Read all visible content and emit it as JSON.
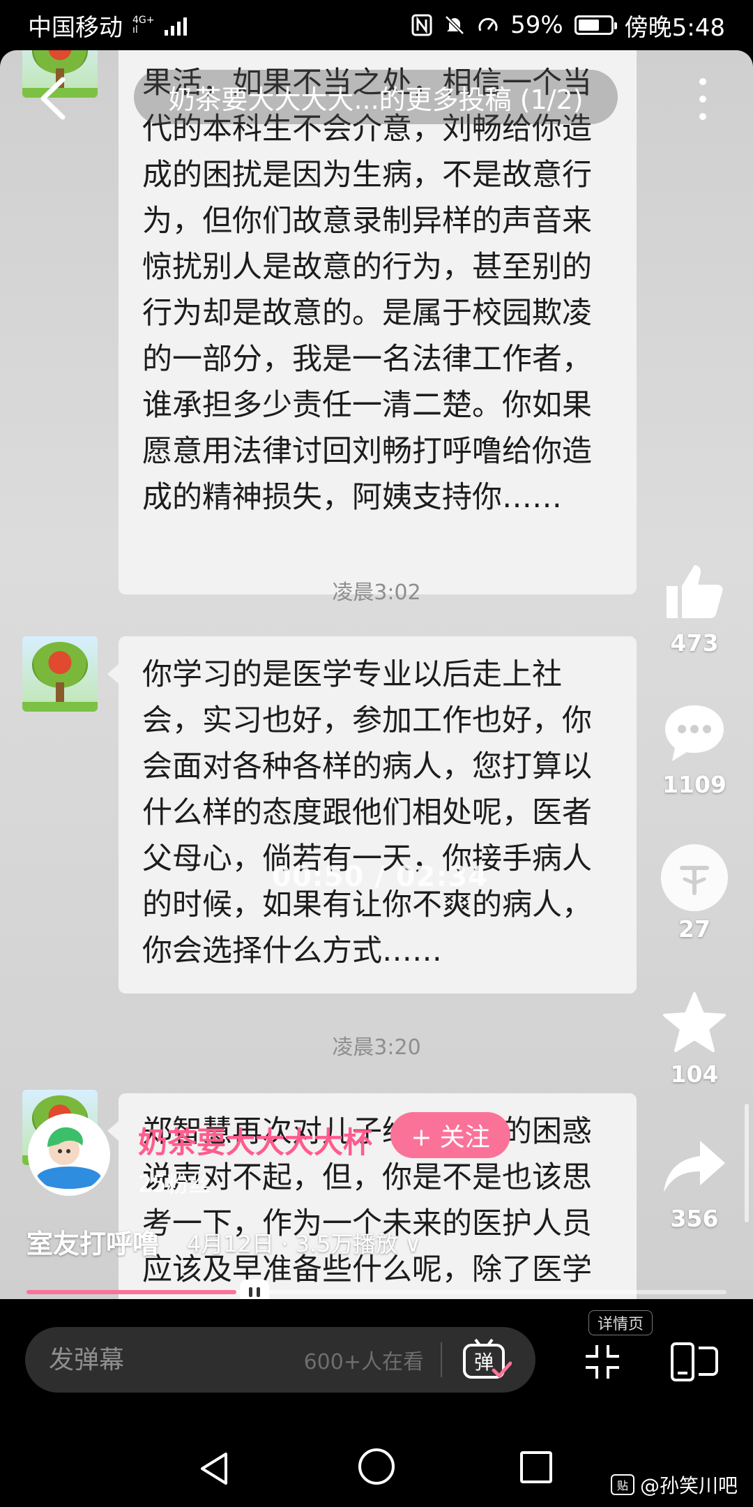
{
  "status_bar": {
    "carrier": "中国移动",
    "network_top": "4G+",
    "network_bottom": "ıl",
    "battery_percent": "59%",
    "battery_level": 0.59,
    "time": "傍晚5:48",
    "icons": [
      "nfc-icon",
      "mute-bell-icon",
      "speed-icon",
      "battery-icon"
    ]
  },
  "header": {
    "title": "奶茶要大大大大...的更多投稿 (1/2)"
  },
  "chat": {
    "bubble1": "果活，如果不当之处，相信一个当代的本科生不会介意，刘畅给你造成的困扰是因为生病，不是故意行为，但你们故意录制异样的声音来惊扰别人是故意的行为，甚至别的行为却是故意的。是属于校园欺凌的一部分，我是一名法律工作者，谁承担多少责任一清二楚。你如果愿意用法律讨回刘畅打呼噜给你造成的精神损失，阿姨支持你……",
    "time1": "凌晨3:02",
    "bubble2": "你学习的是医学专业以后走上社会，实习也好，参加工作也好，你会面对各种各样的病人，您打算以什么样的态度跟他们相处呢，医者父母心，倘若有一天，你接手病人的时候，如果有让你不爽的病人，你会选择什么方式……",
    "time2": "凌晨3:20",
    "bubble3": "郑智慧再次对儿子给你造成的困惑说声对不起，但，你是不是也该思考一下，作为一个未来的医护人员应该及早准备些什么呢，除了医学"
  },
  "video": {
    "elapsed_overlay": "00:50 / 02:34",
    "progress": 0.3
  },
  "actions": {
    "like": "473",
    "comment": "1109",
    "coin": "27",
    "favorite": "104",
    "share": "356"
  },
  "uploader": {
    "name": "奶茶要大大大大杯",
    "follow_label": "+ 关注",
    "fans": "25粉丝"
  },
  "video_info": {
    "title": "室友打呼噜",
    "meta": "4月12日 · 3.5万播放 ∨"
  },
  "bottom": {
    "danmaku_placeholder": "发弹幕",
    "viewers": "600+人在看",
    "danmaku_toggle": "弹",
    "detail_label": "详情页"
  },
  "watermark": {
    "logo": "贴",
    "text": "@孙笑川吧"
  },
  "colors": {
    "accent_pink": "#fb7299",
    "name_pink": "#ff5c8d",
    "bubble_bg": "#f2f2f2",
    "video_bg": "#d4d4d4"
  }
}
